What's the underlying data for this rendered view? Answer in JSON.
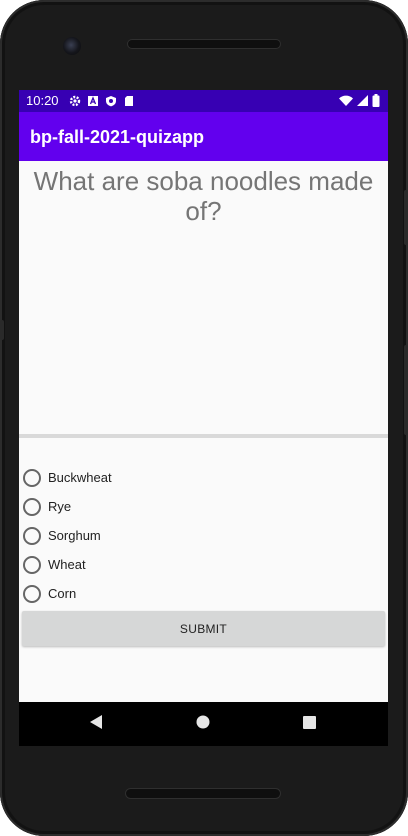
{
  "status_bar": {
    "time": "10:20",
    "icons": [
      "settings-icon",
      "a-icon",
      "shield-icon",
      "sd-card-icon"
    ],
    "system_icons": [
      "wifi-icon",
      "cell-signal-icon",
      "battery-icon"
    ],
    "background": "#3700b3"
  },
  "app_bar": {
    "title": "bp-fall-2021-quizapp",
    "background": "#6200ee"
  },
  "quiz": {
    "question": "What are soba noodles made of?",
    "options": [
      {
        "label": "Buckwheat",
        "selected": false
      },
      {
        "label": "Rye",
        "selected": false
      },
      {
        "label": "Sorghum",
        "selected": false
      },
      {
        "label": "Wheat",
        "selected": false
      },
      {
        "label": "Corn",
        "selected": false
      }
    ],
    "submit_label": "SUBMIT"
  },
  "nav_bar": {
    "buttons": [
      "back-icon",
      "home-icon",
      "recents-icon"
    ]
  }
}
